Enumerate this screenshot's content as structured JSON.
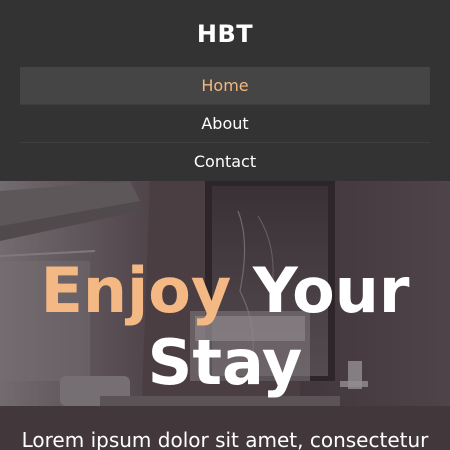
{
  "brand": "HBT",
  "nav": {
    "items": [
      {
        "label": "Home",
        "active": true
      },
      {
        "label": "About",
        "active": false
      },
      {
        "label": "Contact",
        "active": false
      }
    ]
  },
  "hero": {
    "title_accent": "Enjoy",
    "title_rest_1": "Your",
    "title_rest_2": "Stay",
    "text": "Lorem ipsum dolor sit amet, consectetur"
  },
  "colors": {
    "header_bg": "#333333",
    "active_nav_bg": "#454545",
    "accent": "#f4b884",
    "text": "#ffffff"
  }
}
